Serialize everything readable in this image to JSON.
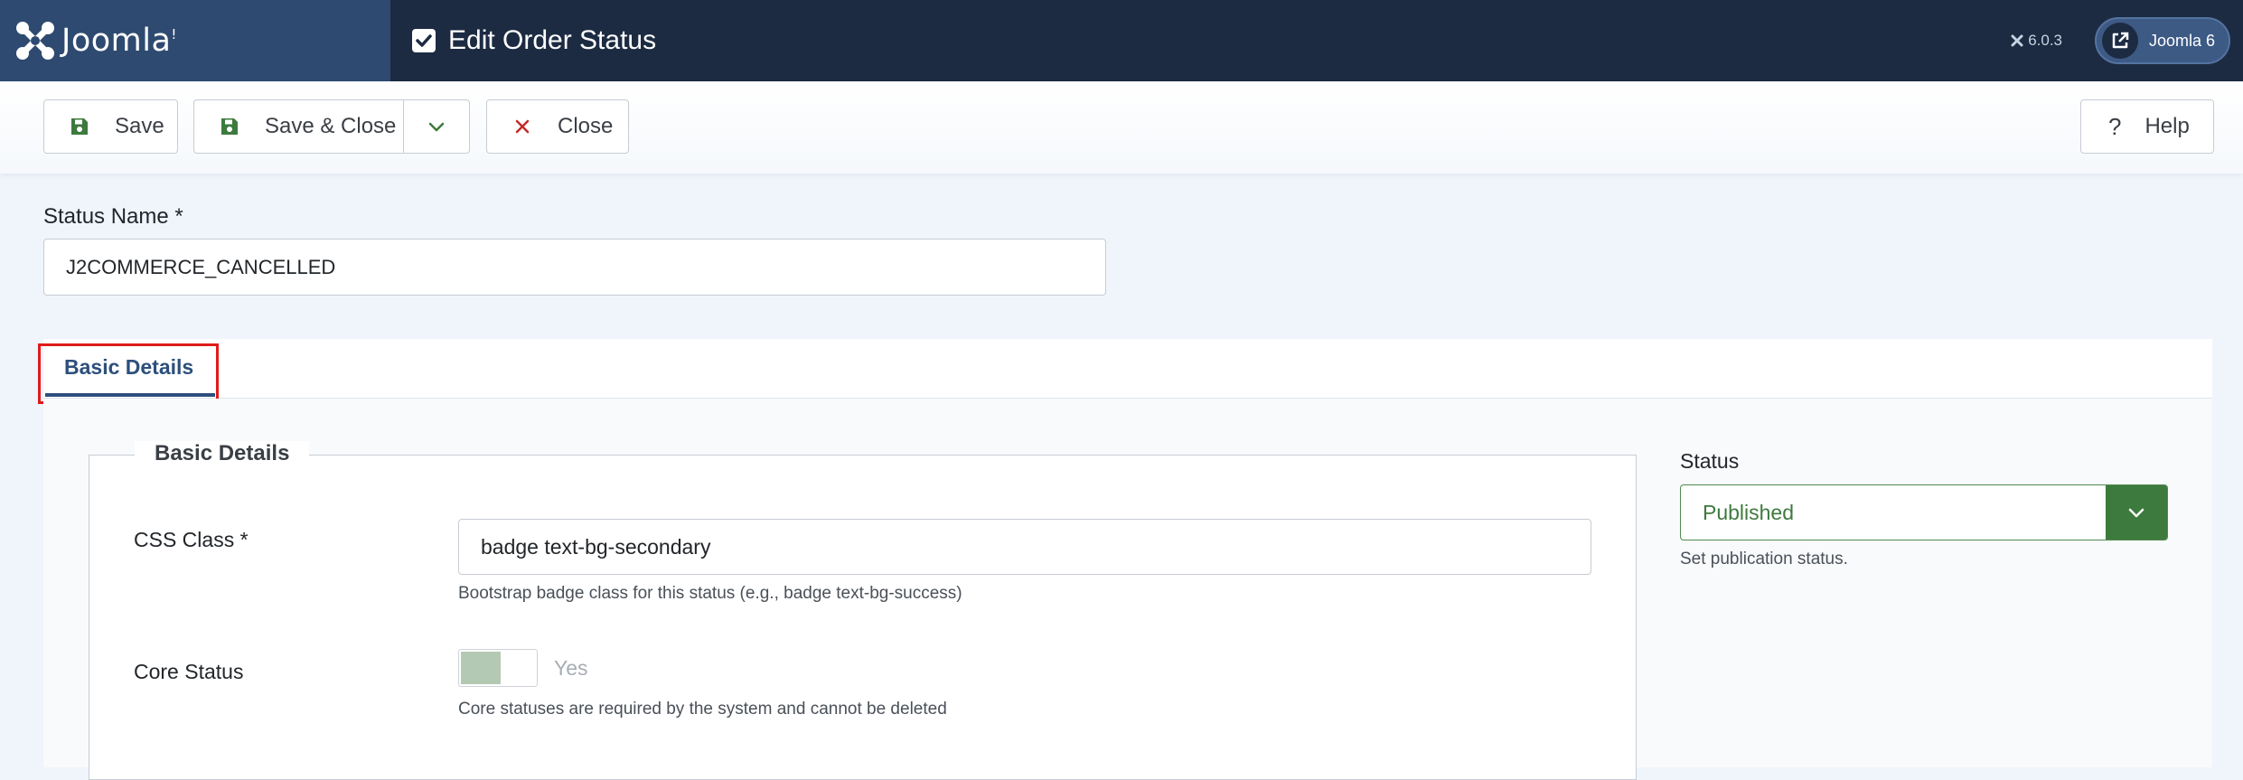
{
  "header": {
    "logo_text": "Joomla!",
    "page_title": "Edit Order Status",
    "version": "6.0.3",
    "site_button_label": "Joomla 6"
  },
  "toolbar": {
    "save_label": "Save",
    "save_close_label": "Save & Close",
    "close_label": "Close",
    "help_label": "Help",
    "help_glyph": "?"
  },
  "form": {
    "status_name_label": "Status Name *",
    "status_name_value": "J2COMMERCE_CANCELLED"
  },
  "tabs": [
    {
      "label": "Basic Details",
      "active": true
    }
  ],
  "basic_details": {
    "legend": "Basic Details",
    "css_class_label": "CSS Class *",
    "css_class_value": "badge text-bg-secondary",
    "css_class_help": "Bootstrap badge class for this status (e.g., badge text-bg-success)",
    "core_status_label": "Core Status",
    "core_status_toggle_text": "Yes",
    "core_status_help": "Core statuses are required by the system and cannot be deleted"
  },
  "status": {
    "label": "Status",
    "value": "Published",
    "help": "Set publication status."
  },
  "colors": {
    "header_bg": "#1c2b42",
    "logo_bg": "#2e4a70",
    "accent": "#2d4f7c",
    "success": "#3d7a3d",
    "highlight": "#e01b1b"
  }
}
